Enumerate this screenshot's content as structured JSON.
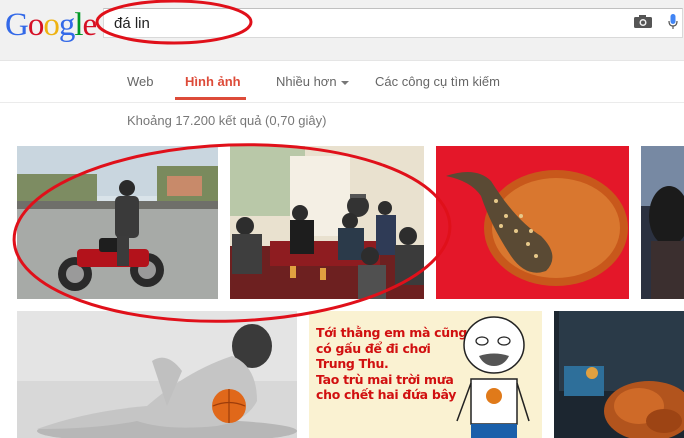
{
  "search": {
    "query": "đá lin"
  },
  "logo": {
    "letters": [
      "G",
      "o",
      "o",
      "g",
      "l",
      "e"
    ],
    "colors": [
      "#3369e8",
      "#d50f25",
      "#eeb211",
      "#3369e8",
      "#009925",
      "#d50f25"
    ]
  },
  "nav": {
    "web": "Web",
    "images": "Hình ảnh",
    "more": "Nhiều hơn",
    "tools": "Các công cụ tìm kiếm"
  },
  "results": {
    "stats": "Khoảng 17.200 kết quả (0,70 giây)"
  },
  "meme": {
    "lines": [
      "Tới thằng em mà cũng",
      "có gấu để đi chơi",
      "Trung Thu.",
      "Tao trù mai trời mưa",
      "cho chết hai đứa bây"
    ]
  },
  "accent": "#dd4b39",
  "annotation_color": "#e0101a"
}
